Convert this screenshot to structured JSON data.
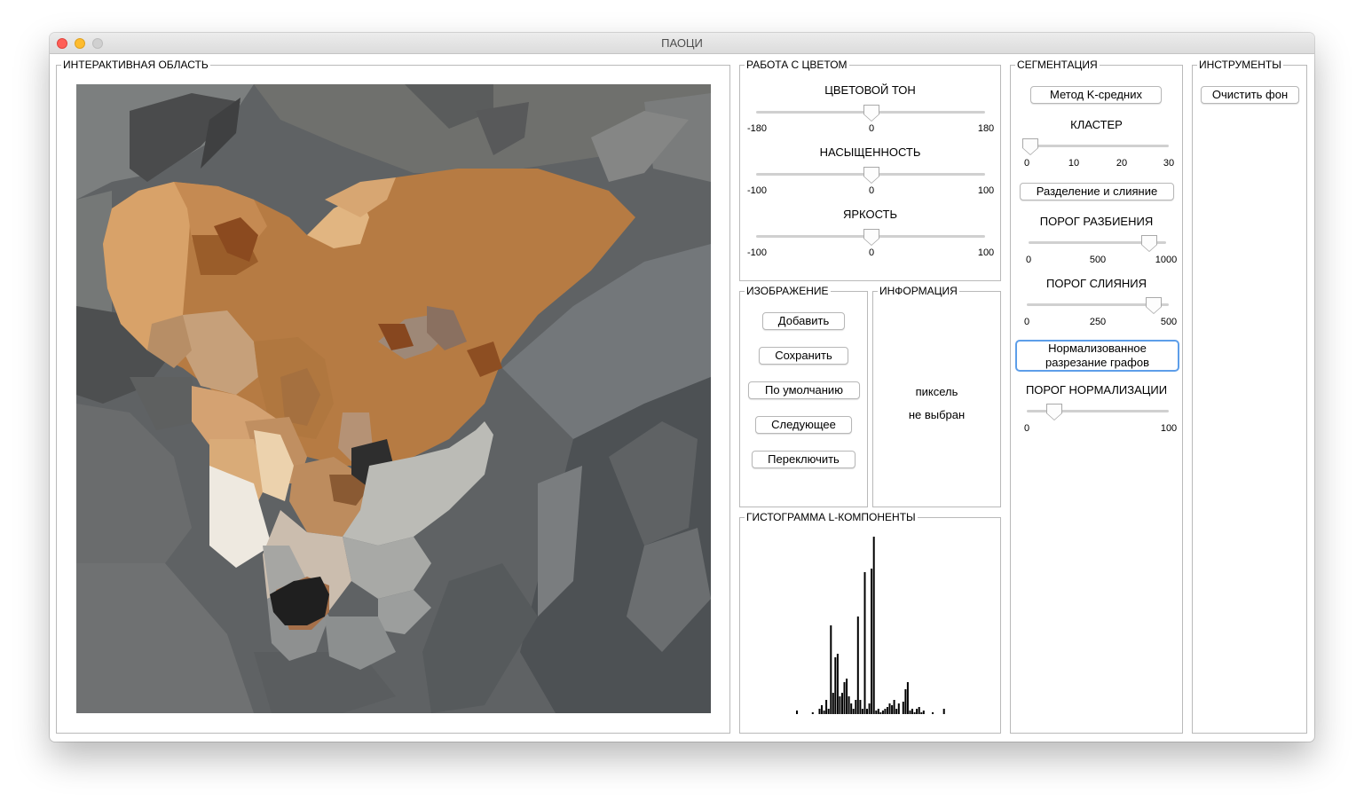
{
  "window": {
    "title": "ПАОЦИ"
  },
  "interactive": {
    "legend": "ИНТЕРАКТИВНАЯ ОБЛАСТЬ"
  },
  "color_panel": {
    "legend": "РАБОТА С ЦВЕТОМ",
    "hue": {
      "label": "ЦВЕТОВОЙ ТОН",
      "min": "-180",
      "mid": "0",
      "max": "180",
      "value": 0
    },
    "saturation": {
      "label": "НАСЫЩЕННОСТЬ",
      "min": "-100",
      "mid": "0",
      "max": "100",
      "value": 0
    },
    "brightness": {
      "label": "ЯРКОСТЬ",
      "min": "-100",
      "mid": "0",
      "max": "100",
      "value": 0
    }
  },
  "image_panel": {
    "legend": "ИЗОБРАЖЕНИЕ",
    "add": "Добавить",
    "save": "Сохранить",
    "default": "По умолчанию",
    "next": "Следующее",
    "toggle": "Переключить"
  },
  "info_panel": {
    "legend": "ИНФОРМАЦИЯ",
    "line1": "пиксель",
    "line2": "не выбран"
  },
  "histogram": {
    "legend": "ГИСТОГРАММА L-КОМПОНЕНТЫ"
  },
  "segmentation": {
    "legend": "СЕГМЕНТАЦИЯ",
    "kmeans": "Метод K-средних",
    "cluster": {
      "label": "КЛАСТЕР",
      "ticks": [
        "0",
        "10",
        "20",
        "30"
      ],
      "value": 0
    },
    "split_merge": "Разделение и слияние",
    "split_threshold": {
      "label": "ПОРОГ РАЗБИЕНИЯ",
      "ticks": [
        "0",
        "500",
        "1000"
      ],
      "value": 880
    },
    "merge_threshold": {
      "label": "ПОРОГ СЛИЯНИЯ",
      "ticks": [
        "0",
        "250",
        "500"
      ],
      "value": 480
    },
    "ncut_line1": "Нормализованное",
    "ncut_line2": "разрезание графов",
    "norm_threshold": {
      "label": "ПОРОГ НОРМАЛИЗАЦИИ",
      "ticks": [
        "0",
        "100"
      ],
      "value": 20
    }
  },
  "tools": {
    "legend": "ИНСТРУМЕНТЫ",
    "clear_bg": "Очистить фон"
  },
  "chart_data": {
    "type": "bar",
    "title": "ГИСТОГРАММА L-КОМПОНЕНТЫ",
    "xlabel": "",
    "ylabel": "",
    "x": [
      20,
      27,
      30,
      31,
      32,
      33,
      34,
      35,
      36,
      37,
      38,
      39,
      40,
      41,
      42,
      43,
      44,
      45,
      46,
      47,
      48,
      49,
      50,
      51,
      52,
      53,
      54,
      55,
      56,
      57,
      58,
      59,
      60,
      61,
      62,
      63,
      64,
      65,
      67,
      68,
      69,
      70,
      71,
      72,
      73,
      74,
      75,
      76,
      80,
      85
    ],
    "values": [
      2,
      1,
      3,
      5,
      2,
      8,
      3,
      50,
      12,
      32,
      34,
      10,
      12,
      18,
      20,
      10,
      6,
      3,
      8,
      55,
      8,
      3,
      80,
      3,
      6,
      82,
      100,
      2,
      3,
      1,
      2,
      3,
      4,
      6,
      5,
      8,
      3,
      6,
      7,
      14,
      18,
      2,
      3,
      1,
      3,
      4,
      1,
      2,
      1,
      3
    ],
    "ylim": [
      0,
      100
    ],
    "grid": false,
    "legend": "none"
  },
  "colors": {
    "focus_ring": "#5d9ee9",
    "panel_border": "#b9b9b9",
    "bar": "#000000"
  }
}
